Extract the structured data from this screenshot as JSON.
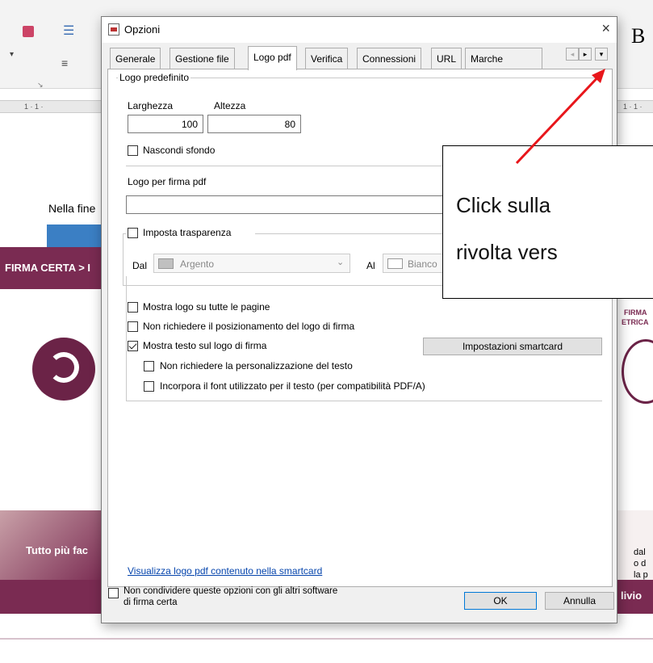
{
  "background": {
    "ruler_marks": "1 · 1 ·",
    "doc_text_1": "Nella fine",
    "band_1": "FIRMA CERTA > I",
    "band_2": "Tutto più fac",
    "right_snippet_1": "FIRMA",
    "right_snippet_2": "ETRICA",
    "right_snippet_3": "dal",
    "right_snippet_4": "o d",
    "right_snippet_5": "la p",
    "right_snippet_6": "livio",
    "letter_b": "B"
  },
  "dialog": {
    "title": "Opzioni",
    "tabs": [
      "Generale",
      "Gestione file",
      "Logo pdf",
      "Verifica",
      "Connessioni",
      "URL",
      "Marche"
    ],
    "active_tab": "Logo pdf",
    "logo_predefinito": {
      "group_label": "Logo predefinito",
      "width_label": "Larghezza",
      "height_label": "Altezza",
      "width_value": "100",
      "height_value": "80",
      "hide_bg_label": "Nascondi sfondo",
      "hide_bg_checked": false
    },
    "logo_firma_pdf": {
      "label": "Logo per firma pdf",
      "value": ""
    },
    "trasparenza": {
      "label": "Imposta trasparenza",
      "checked": false,
      "from_label": "Dal",
      "from_value": "Argento",
      "to_label": "Al",
      "to_value": "Bianco"
    },
    "options": [
      {
        "label": "Mostra logo su tutte le pagine",
        "checked": false
      },
      {
        "label": "Non richiedere il posizionamento del logo di firma",
        "checked": false
      },
      {
        "label": "Mostra testo sul logo di firma",
        "checked": true
      },
      {
        "label": "Non richiedere la personalizzazione del testo",
        "checked": false
      },
      {
        "label": "Incorpora il font utilizzato per il testo (per compatibilità PDF/A)",
        "checked": false
      }
    ],
    "smartcard_button": "Impostazioni smartcard",
    "smartcard_link": "Visualizza logo pdf contenuto nella smartcard",
    "footer_checkbox_line1": "Non condividere queste opzioni con gli altri software",
    "footer_checkbox_line2": "di firma certa",
    "ok_label": "OK",
    "cancel_label": "Annulla",
    "close_glyph": "×"
  },
  "callout": {
    "line1": "Click sulla",
    "line2": "rivolta vers"
  },
  "colors": {
    "brand_purple": "#7a2b52",
    "arrow_red": "#e8161b",
    "link_blue": "#0645ad"
  }
}
